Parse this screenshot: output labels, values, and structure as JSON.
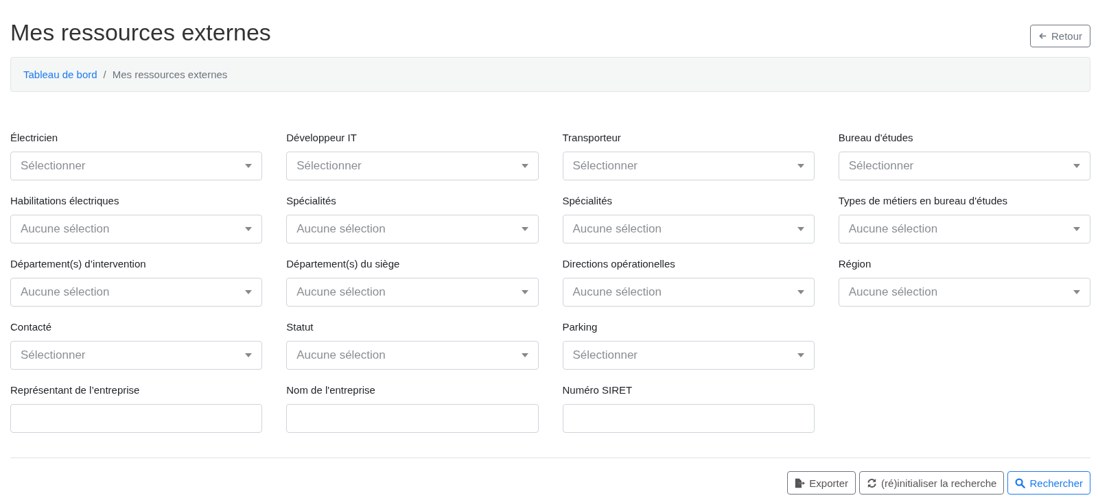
{
  "page": {
    "title": "Mes ressources externes",
    "back_button": "Retour"
  },
  "breadcrumb": [
    {
      "label": "Tableau de bord",
      "link": true
    },
    {
      "label": "Mes ressources externes",
      "link": false,
      "separator": "/"
    }
  ],
  "filters": [
    [
      {
        "label": "Électricien",
        "kind": "select",
        "placeholder": "Sélectionner"
      },
      {
        "label": "Développeur IT",
        "kind": "select",
        "placeholder": "Sélectionner"
      },
      {
        "label": "Transporteur",
        "kind": "select",
        "placeholder": "Sélectionner"
      },
      {
        "label": "Bureau d'études",
        "kind": "select",
        "placeholder": "Sélectionner"
      }
    ],
    [
      {
        "label": "Habilitations électriques",
        "kind": "select",
        "placeholder": "Aucune sélection"
      },
      {
        "label": "Spécialités",
        "kind": "select",
        "placeholder": "Aucune sélection"
      },
      {
        "label": "Spécialités",
        "kind": "select",
        "placeholder": "Aucune sélection"
      },
      {
        "label": "Types de métiers en bureau d'études",
        "kind": "select",
        "placeholder": "Aucune sélection"
      }
    ],
    [
      {
        "label": "Département(s) d’intervention",
        "kind": "select",
        "placeholder": "Aucune sélection"
      },
      {
        "label": "Département(s) du siège",
        "kind": "select",
        "placeholder": "Aucune sélection"
      },
      {
        "label": "Directions opérationelles",
        "kind": "select",
        "placeholder": "Aucune sélection"
      },
      {
        "label": "Région",
        "kind": "select",
        "placeholder": "Aucune sélection"
      }
    ],
    [
      {
        "label": "Contacté",
        "kind": "select",
        "placeholder": "Sélectionner"
      },
      {
        "label": "Statut",
        "kind": "select",
        "placeholder": "Aucune sélection"
      },
      {
        "label": "Parking",
        "kind": "select",
        "placeholder": "Sélectionner"
      }
    ],
    [
      {
        "label": "Représentant de l’entreprise",
        "kind": "text"
      },
      {
        "label": "Nom de l'entreprise",
        "kind": "text"
      },
      {
        "label": "Numéro SIRET",
        "kind": "text"
      }
    ]
  ],
  "actions": [
    {
      "label": "Exporter",
      "kind": "export"
    },
    {
      "label": "(ré)initialiser la recherche",
      "kind": "reset"
    },
    {
      "label": "Rechercher",
      "kind": "search"
    }
  ]
}
